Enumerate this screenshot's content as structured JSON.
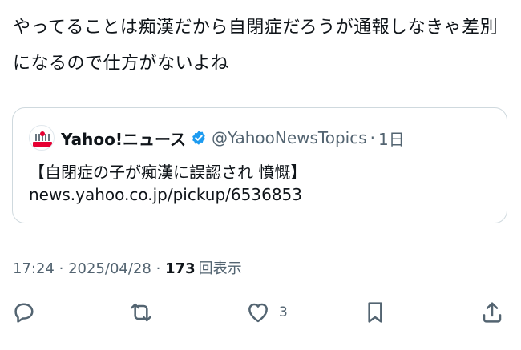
{
  "tweet": {
    "text": "やってることは痴漢だから自閉症だろうが通報しなきゃ差別になるので仕方がないよね"
  },
  "quote": {
    "name": "Yahoo!ニュース",
    "handle": "@YahooNewsTopics",
    "separator": "·",
    "time": "1日",
    "title": "【自閉症の子が痴漢に誤認され 憤慨】",
    "link": "news.yahoo.co.jp/pickup/6536853",
    "verified_color": "#1d9bf0"
  },
  "meta": {
    "time": "17:24",
    "date": "2025/04/28",
    "views_count": "173",
    "views_label": "回表示",
    "separator": "·"
  },
  "actions": {
    "reply_icon": "reply-icon",
    "retweet_icon": "retweet-icon",
    "like_icon": "heart-icon",
    "like_count": "3",
    "bookmark_icon": "bookmark-icon",
    "share_icon": "share-icon",
    "icon_color": "#536471"
  }
}
